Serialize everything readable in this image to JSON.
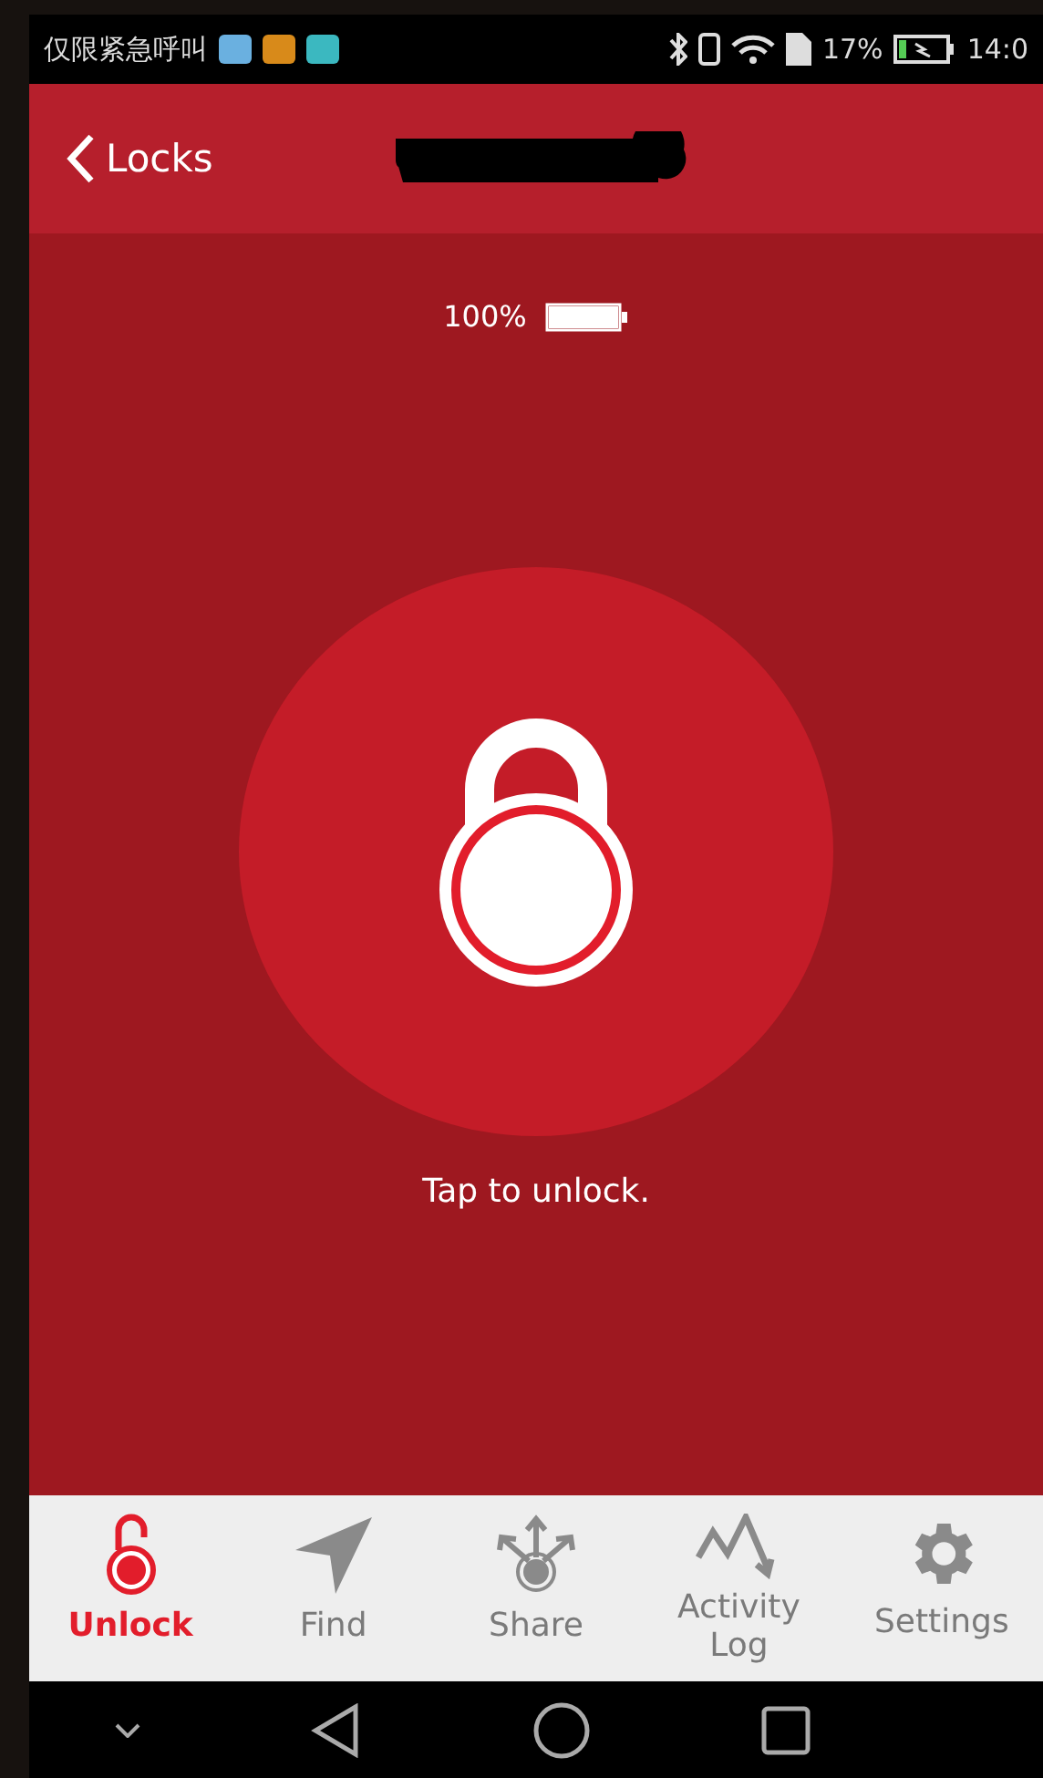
{
  "status_bar": {
    "carrier": "仅限紧急呼叫",
    "battery": "17%",
    "time": "14:0"
  },
  "header": {
    "back_label": "Locks"
  },
  "lock": {
    "battery_percent": "100%",
    "level": 1,
    "locked": true,
    "hint": "Tap to unlock."
  },
  "tabs": [
    {
      "label": "Unlock",
      "kind": "unlock",
      "selected": true
    },
    {
      "label": "Find",
      "kind": "find",
      "selected": false
    },
    {
      "label": "Share",
      "kind": "share",
      "selected": false
    },
    {
      "label": "Activity Log",
      "kind": "activity",
      "selected": false
    },
    {
      "label": "Settings",
      "kind": "settings",
      "selected": false
    }
  ]
}
